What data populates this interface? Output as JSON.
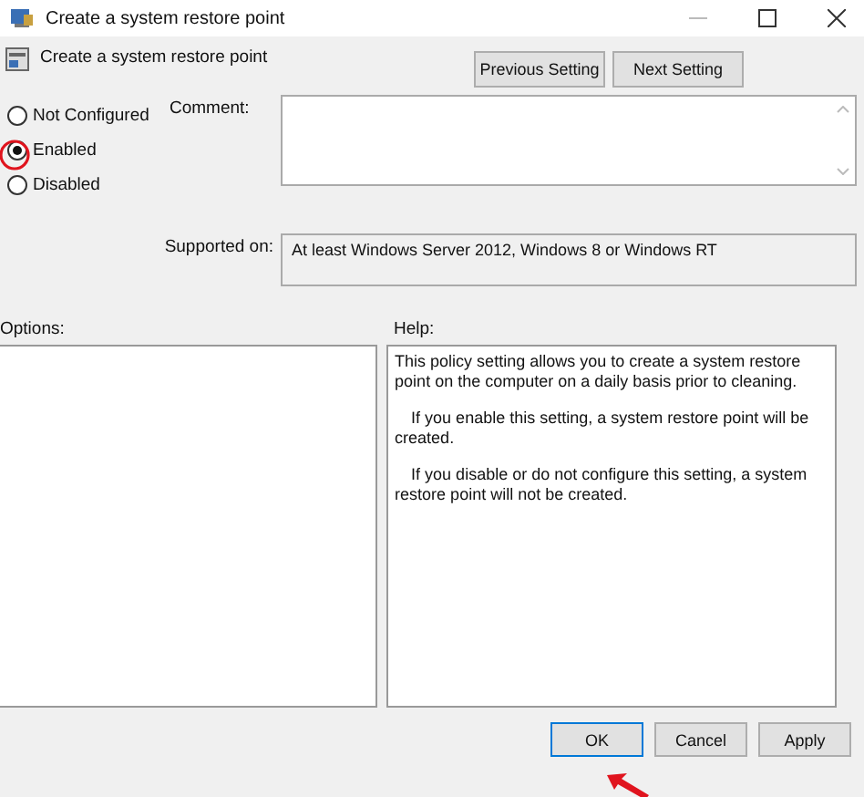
{
  "window": {
    "title": "Create a system restore point"
  },
  "header": {
    "title": "Create a system restore point",
    "buttons": [
      "Previous Setting",
      "Next Setting"
    ]
  },
  "state_options": [
    {
      "label": "Not Configured",
      "selected": false
    },
    {
      "label": "Enabled",
      "selected": true
    },
    {
      "label": "Disabled",
      "selected": false
    }
  ],
  "comment": {
    "label": "Comment:"
  },
  "supported_on": {
    "label": "Supported on:",
    "value": "At least Windows Server 2012, Windows 8 or Windows RT"
  },
  "options": {
    "label": "Options:"
  },
  "help": {
    "label": "Help:",
    "paragraphs": [
      "This policy setting allows you to create a system restore point on the computer on a daily basis prior to cleaning.",
      "If you enable this setting, a system restore point will be created.",
      "If you disable or do not configure this setting, a system restore point will not be created."
    ]
  },
  "buttons": [
    {
      "label": "OK",
      "default": true
    },
    {
      "label": "Cancel",
      "default": false
    },
    {
      "label": "Apply",
      "default": false
    }
  ]
}
